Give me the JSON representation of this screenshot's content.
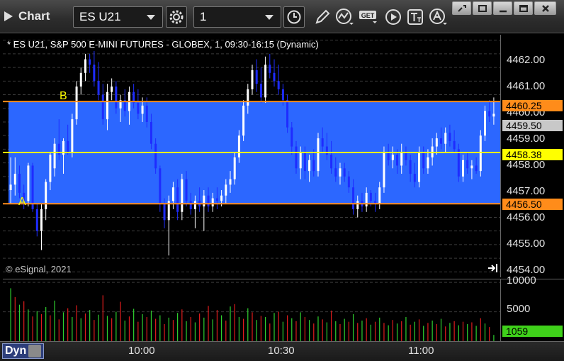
{
  "toolbar": {
    "title": "Chart",
    "symbol": "ES U21",
    "interval": "1"
  },
  "chart": {
    "header": "* ES U21, S&P 500 E-MINI FUTURES - GLOBEX, 1, 09:30-16:15 (Dynamic)",
    "copyright": "© eSignal, 2021",
    "label_b": "B",
    "label_a": "A",
    "band_color": "#2c67ff",
    "line_color_orange": "#ff8c1a",
    "line_color_yellow": "#ffff00",
    "candle_up_color": "#ffffff",
    "candle_down_color": "#1e2cff",
    "vol_up_color": "#2fd12f",
    "vol_down_color": "#e01c1c"
  },
  "price_scale": {
    "ticks": [
      "4462.00",
      "4461.00",
      "4460.00",
      "4459.00",
      "4458.00",
      "4457.00",
      "4456.00",
      "4455.00",
      "4454.00"
    ],
    "badges": {
      "upper_line": "4460.25",
      "last_price": "4459.50",
      "mid_line": "4458.38",
      "lower_line": "4456.50"
    }
  },
  "volume_scale": {
    "ticks": [
      "10000",
      "5000"
    ],
    "badge": "1059"
  },
  "time_axis": {
    "dyn_label": "Dyn",
    "ticks": [
      "10:00",
      "10:30",
      "11:00"
    ]
  },
  "chart_data": {
    "type": "candlestick",
    "ylim": [
      4453.8,
      4462.7
    ],
    "levels": {
      "upper": 4460.25,
      "mid": 4458.38,
      "lower": 4456.5
    },
    "candles": [
      [
        4457.0,
        4458.2,
        4456.5,
        4457.2
      ],
      [
        4457.2,
        4458.2,
        4456.8,
        4457.6
      ],
      [
        4457.6,
        4457.9,
        4456.7,
        4456.9
      ],
      [
        4456.9,
        4457.2,
        4456.3,
        4456.6
      ],
      [
        4456.6,
        4458.0,
        4456.4,
        4457.9
      ],
      [
        4457.9,
        4458.0,
        4456.2,
        4456.3
      ],
      [
        4456.3,
        4456.5,
        4455.3,
        4455.5
      ],
      [
        4455.5,
        4456.5,
        4454.8,
        4456.3
      ],
      [
        4456.3,
        4457.4,
        4455.9,
        4457.3
      ],
      [
        4457.3,
        4458.4,
        4457.0,
        4458.3
      ],
      [
        4457.8,
        4458.9,
        4457.5,
        4458.7
      ],
      [
        4458.7,
        4459.6,
        4458.1,
        4458.3
      ],
      [
        4458.3,
        4458.9,
        4457.6,
        4458.8
      ],
      [
        4458.8,
        4459.4,
        4458.3,
        4458.4
      ],
      [
        4458.4,
        4459.8,
        4458.2,
        4459.6
      ],
      [
        4459.6,
        4461.0,
        4459.4,
        4460.8
      ],
      [
        4460.8,
        4461.5,
        4460.5,
        4461.3
      ],
      [
        4461.3,
        4462.0,
        4461.0,
        4461.8
      ],
      [
        4461.8,
        4462.0,
        4461.3,
        4461.6
      ],
      [
        4461.6,
        4462.1,
        4460.8,
        4461.0
      ],
      [
        4461.0,
        4461.7,
        4460.3,
        4460.5
      ],
      [
        4460.5,
        4460.9,
        4459.4,
        4459.6
      ],
      [
        4459.6,
        4460.9,
        4459.2,
        4460.6
      ],
      [
        4460.6,
        4461.1,
        4460.3,
        4460.8
      ],
      [
        4460.8,
        4461.0,
        4459.8,
        4460.0
      ],
      [
        4460.0,
        4460.5,
        4459.5,
        4460.3
      ],
      [
        4460.3,
        4460.7,
        4459.7,
        4459.9
      ],
      [
        4459.9,
        4460.8,
        4459.4,
        4460.6
      ],
      [
        4460.6,
        4460.9,
        4460.0,
        4460.2
      ],
      [
        4460.2,
        4460.7,
        4459.6,
        4459.8
      ],
      [
        4459.8,
        4460.4,
        4459.5,
        4460.1
      ],
      [
        4460.1,
        4460.4,
        4459.3,
        4459.5
      ],
      [
        4459.5,
        4459.8,
        4458.5,
        4458.7
      ],
      [
        4458.7,
        4458.9,
        4457.6,
        4457.8
      ],
      [
        4457.8,
        4457.9,
        4456.2,
        4456.5
      ],
      [
        4456.5,
        4456.7,
        4455.6,
        4455.9
      ],
      [
        4455.9,
        4456.8,
        4454.6,
        4456.6
      ],
      [
        4456.6,
        4457.3,
        4456.3,
        4457.1
      ],
      [
        4457.1,
        4457.4,
        4455.9,
        4456.2
      ],
      [
        4456.2,
        4457.6,
        4455.9,
        4457.4
      ],
      [
        4457.4,
        4457.7,
        4456.4,
        4456.6
      ],
      [
        4456.6,
        4456.9,
        4456.1,
        4456.3
      ],
      [
        4456.3,
        4456.8,
        4455.6,
        4456.6
      ],
      [
        4456.6,
        4457.1,
        4456.2,
        4456.4
      ],
      [
        4456.4,
        4457.0,
        4455.5,
        4456.8
      ],
      [
        4456.8,
        4457.1,
        4456.2,
        4456.4
      ],
      [
        4456.4,
        4456.9,
        4456.2,
        4456.7
      ],
      [
        4456.7,
        4457.1,
        4456.3,
        4456.6
      ],
      [
        4456.6,
        4457.0,
        4456.4,
        4456.8
      ],
      [
        4456.8,
        4457.4,
        4456.5,
        4457.2
      ],
      [
        4457.2,
        4457.7,
        4456.9,
        4457.4
      ],
      [
        4457.4,
        4458.4,
        4457.2,
        4458.2
      ],
      [
        4458.2,
        4459.2,
        4458.0,
        4459.0
      ],
      [
        4459.0,
        4460.3,
        4458.8,
        4460.1
      ],
      [
        4460.1,
        4460.9,
        4459.8,
        4460.7
      ],
      [
        4460.7,
        4461.6,
        4460.5,
        4461.4
      ],
      [
        4461.4,
        4461.8,
        4460.6,
        4460.9
      ],
      [
        4460.9,
        4461.5,
        4460.2,
        4460.4
      ],
      [
        4460.4,
        4461.9,
        4460.2,
        4461.6
      ],
      [
        4461.6,
        4462.0,
        4461.1,
        4461.3
      ],
      [
        4461.3,
        4461.8,
        4460.8,
        4461.0
      ],
      [
        4461.0,
        4461.6,
        4460.5,
        4460.7
      ],
      [
        4460.7,
        4460.9,
        4460.1,
        4460.3
      ],
      [
        4460.3,
        4460.5,
        4459.1,
        4459.3
      ],
      [
        4459.3,
        4459.5,
        4458.3,
        4458.6
      ],
      [
        4458.6,
        4458.8,
        4457.6,
        4457.8
      ],
      [
        4457.8,
        4458.6,
        4457.4,
        4458.4
      ],
      [
        4458.4,
        4458.6,
        4457.4,
        4457.7
      ],
      [
        4457.7,
        4458.3,
        4457.3,
        4458.1
      ],
      [
        4458.1,
        4458.5,
        4457.5,
        4457.7
      ],
      [
        4457.7,
        4459.1,
        4457.5,
        4458.9
      ],
      [
        4458.9,
        4459.3,
        4458.4,
        4458.6
      ],
      [
        4458.6,
        4459.1,
        4458.1,
        4458.3
      ],
      [
        4458.3,
        4458.8,
        4457.6,
        4457.8
      ],
      [
        4457.8,
        4458.2,
        4457.3,
        4457.5
      ],
      [
        4457.5,
        4458.0,
        4457.2,
        4457.8
      ],
      [
        4457.8,
        4458.0,
        4457.3,
        4457.5
      ],
      [
        4457.5,
        4457.7,
        4456.9,
        4457.1
      ],
      [
        4457.1,
        4457.4,
        4456.1,
        4456.3
      ],
      [
        4456.3,
        4456.8,
        4456.0,
        4456.6
      ],
      [
        4456.6,
        4456.9,
        4456.2,
        4456.4
      ],
      [
        4456.4,
        4457.1,
        4456.2,
        4456.9
      ],
      [
        4456.9,
        4457.0,
        4456.4,
        4456.6
      ],
      [
        4456.6,
        4456.9,
        4456.2,
        4456.5
      ],
      [
        4456.5,
        4457.3,
        4456.3,
        4457.1
      ],
      [
        4457.1,
        4458.6,
        4456.9,
        4458.4
      ],
      [
        4458.4,
        4458.7,
        4457.9,
        4458.1
      ],
      [
        4458.1,
        4458.6,
        4457.8,
        4458.3
      ],
      [
        4458.3,
        4458.5,
        4457.6,
        4457.9
      ],
      [
        4457.9,
        4458.7,
        4457.6,
        4458.4
      ],
      [
        4458.4,
        4458.6,
        4457.9,
        4458.1
      ],
      [
        4458.1,
        4458.3,
        4457.3,
        4457.6
      ],
      [
        4457.6,
        4458.0,
        4457.1,
        4457.3
      ],
      [
        4457.3,
        4458.6,
        4457.1,
        4458.4
      ],
      [
        4458.4,
        4458.6,
        4457.6,
        4457.8
      ],
      [
        4457.8,
        4458.5,
        4457.6,
        4458.2
      ],
      [
        4458.2,
        4458.9,
        4457.9,
        4458.6
      ],
      [
        4458.6,
        4459.1,
        4458.3,
        4458.9
      ],
      [
        4458.9,
        4459.3,
        4458.5,
        4458.7
      ],
      [
        4458.7,
        4459.3,
        4458.4,
        4459.1
      ],
      [
        4459.1,
        4459.4,
        4458.6,
        4458.8
      ],
      [
        4458.8,
        4459.2,
        4458.4,
        4458.5
      ],
      [
        4458.5,
        4458.7,
        4457.3,
        4457.5
      ],
      [
        4457.5,
        4458.3,
        4457.3,
        4458.1
      ],
      [
        4458.1,
        4458.4,
        4457.6,
        4457.8
      ],
      [
        4457.8,
        4458.1,
        4457.4,
        4457.9
      ],
      [
        4457.9,
        4458.2,
        4457.6,
        4457.7
      ],
      [
        4457.7,
        4459.2,
        4457.5,
        4459.0
      ],
      [
        4459.0,
        4460.1,
        4458.8,
        4459.9
      ],
      [
        4459.9,
        4460.3,
        4459.5,
        4459.7
      ],
      [
        4459.7,
        4460.4,
        4459.4,
        4459.8
      ]
    ],
    "volumes": [
      [
        9000,
        1
      ],
      [
        7500,
        0
      ],
      [
        6200,
        1
      ],
      [
        6800,
        0
      ],
      [
        5400,
        1
      ],
      [
        4200,
        0
      ],
      [
        5100,
        1
      ],
      [
        4600,
        0
      ],
      [
        5800,
        1
      ],
      [
        4400,
        0
      ],
      [
        6900,
        1
      ],
      [
        3700,
        0
      ],
      [
        4900,
        1
      ],
      [
        5600,
        0
      ],
      [
        4100,
        1
      ],
      [
        6100,
        0
      ],
      [
        3900,
        1
      ],
      [
        4700,
        0
      ],
      [
        5300,
        1
      ],
      [
        3600,
        0
      ],
      [
        4500,
        1
      ],
      [
        7800,
        0
      ],
      [
        4300,
        1
      ],
      [
        3900,
        0
      ],
      [
        5000,
        1
      ],
      [
        6700,
        0
      ],
      [
        3500,
        1
      ],
      [
        4200,
        0
      ],
      [
        5500,
        1
      ],
      [
        3300,
        0
      ],
      [
        4600,
        1
      ],
      [
        4100,
        0
      ],
      [
        5200,
        1
      ],
      [
        3800,
        0
      ],
      [
        4400,
        1
      ],
      [
        2900,
        0
      ],
      [
        4000,
        1
      ],
      [
        3600,
        0
      ],
      [
        4800,
        1
      ],
      [
        5400,
        0
      ],
      [
        3400,
        1
      ],
      [
        4100,
        0
      ],
      [
        3200,
        1
      ],
      [
        4700,
        0
      ],
      [
        4000,
        1
      ],
      [
        6000,
        0
      ],
      [
        3700,
        1
      ],
      [
        5300,
        0
      ],
      [
        4400,
        1
      ],
      [
        3500,
        0
      ],
      [
        5900,
        1
      ],
      [
        6300,
        0
      ],
      [
        4100,
        1
      ],
      [
        3800,
        0
      ],
      [
        5600,
        1
      ],
      [
        4900,
        0
      ],
      [
        3600,
        1
      ],
      [
        4300,
        0
      ],
      [
        4100,
        1
      ],
      [
        3000,
        0
      ],
      [
        4800,
        1
      ],
      [
        5000,
        0
      ],
      [
        3300,
        1
      ],
      [
        4400,
        0
      ],
      [
        3900,
        1
      ],
      [
        3400,
        0
      ],
      [
        4900,
        1
      ],
      [
        4100,
        0
      ],
      [
        3600,
        1
      ],
      [
        3000,
        0
      ],
      [
        4200,
        1
      ],
      [
        3700,
        0
      ],
      [
        3200,
        1
      ],
      [
        5200,
        0
      ],
      [
        3400,
        1
      ],
      [
        2900,
        0
      ],
      [
        3800,
        1
      ],
      [
        3300,
        0
      ],
      [
        4600,
        1
      ],
      [
        3100,
        0
      ],
      [
        3500,
        1
      ],
      [
        3900,
        0
      ],
      [
        2800,
        1
      ],
      [
        3300,
        0
      ],
      [
        4000,
        1
      ],
      [
        3100,
        0
      ],
      [
        2700,
        1
      ],
      [
        3600,
        0
      ],
      [
        3000,
        1
      ],
      [
        3400,
        0
      ],
      [
        4100,
        1
      ],
      [
        2800,
        0
      ],
      [
        3300,
        1
      ],
      [
        3700,
        0
      ],
      [
        2600,
        1
      ],
      [
        3100,
        0
      ],
      [
        3500,
        1
      ],
      [
        2900,
        0
      ],
      [
        3800,
        1
      ],
      [
        2500,
        0
      ],
      [
        3100,
        1
      ],
      [
        3400,
        0
      ],
      [
        2700,
        1
      ],
      [
        3300,
        0
      ],
      [
        2900,
        1
      ],
      [
        3200,
        0
      ],
      [
        2600,
        1
      ],
      [
        3900,
        0
      ],
      [
        3000,
        1
      ],
      [
        2400,
        0
      ],
      [
        1059,
        1
      ]
    ],
    "vol_max": 10500,
    "x_ticks": [
      "10:00",
      "10:30",
      "11:00"
    ]
  }
}
